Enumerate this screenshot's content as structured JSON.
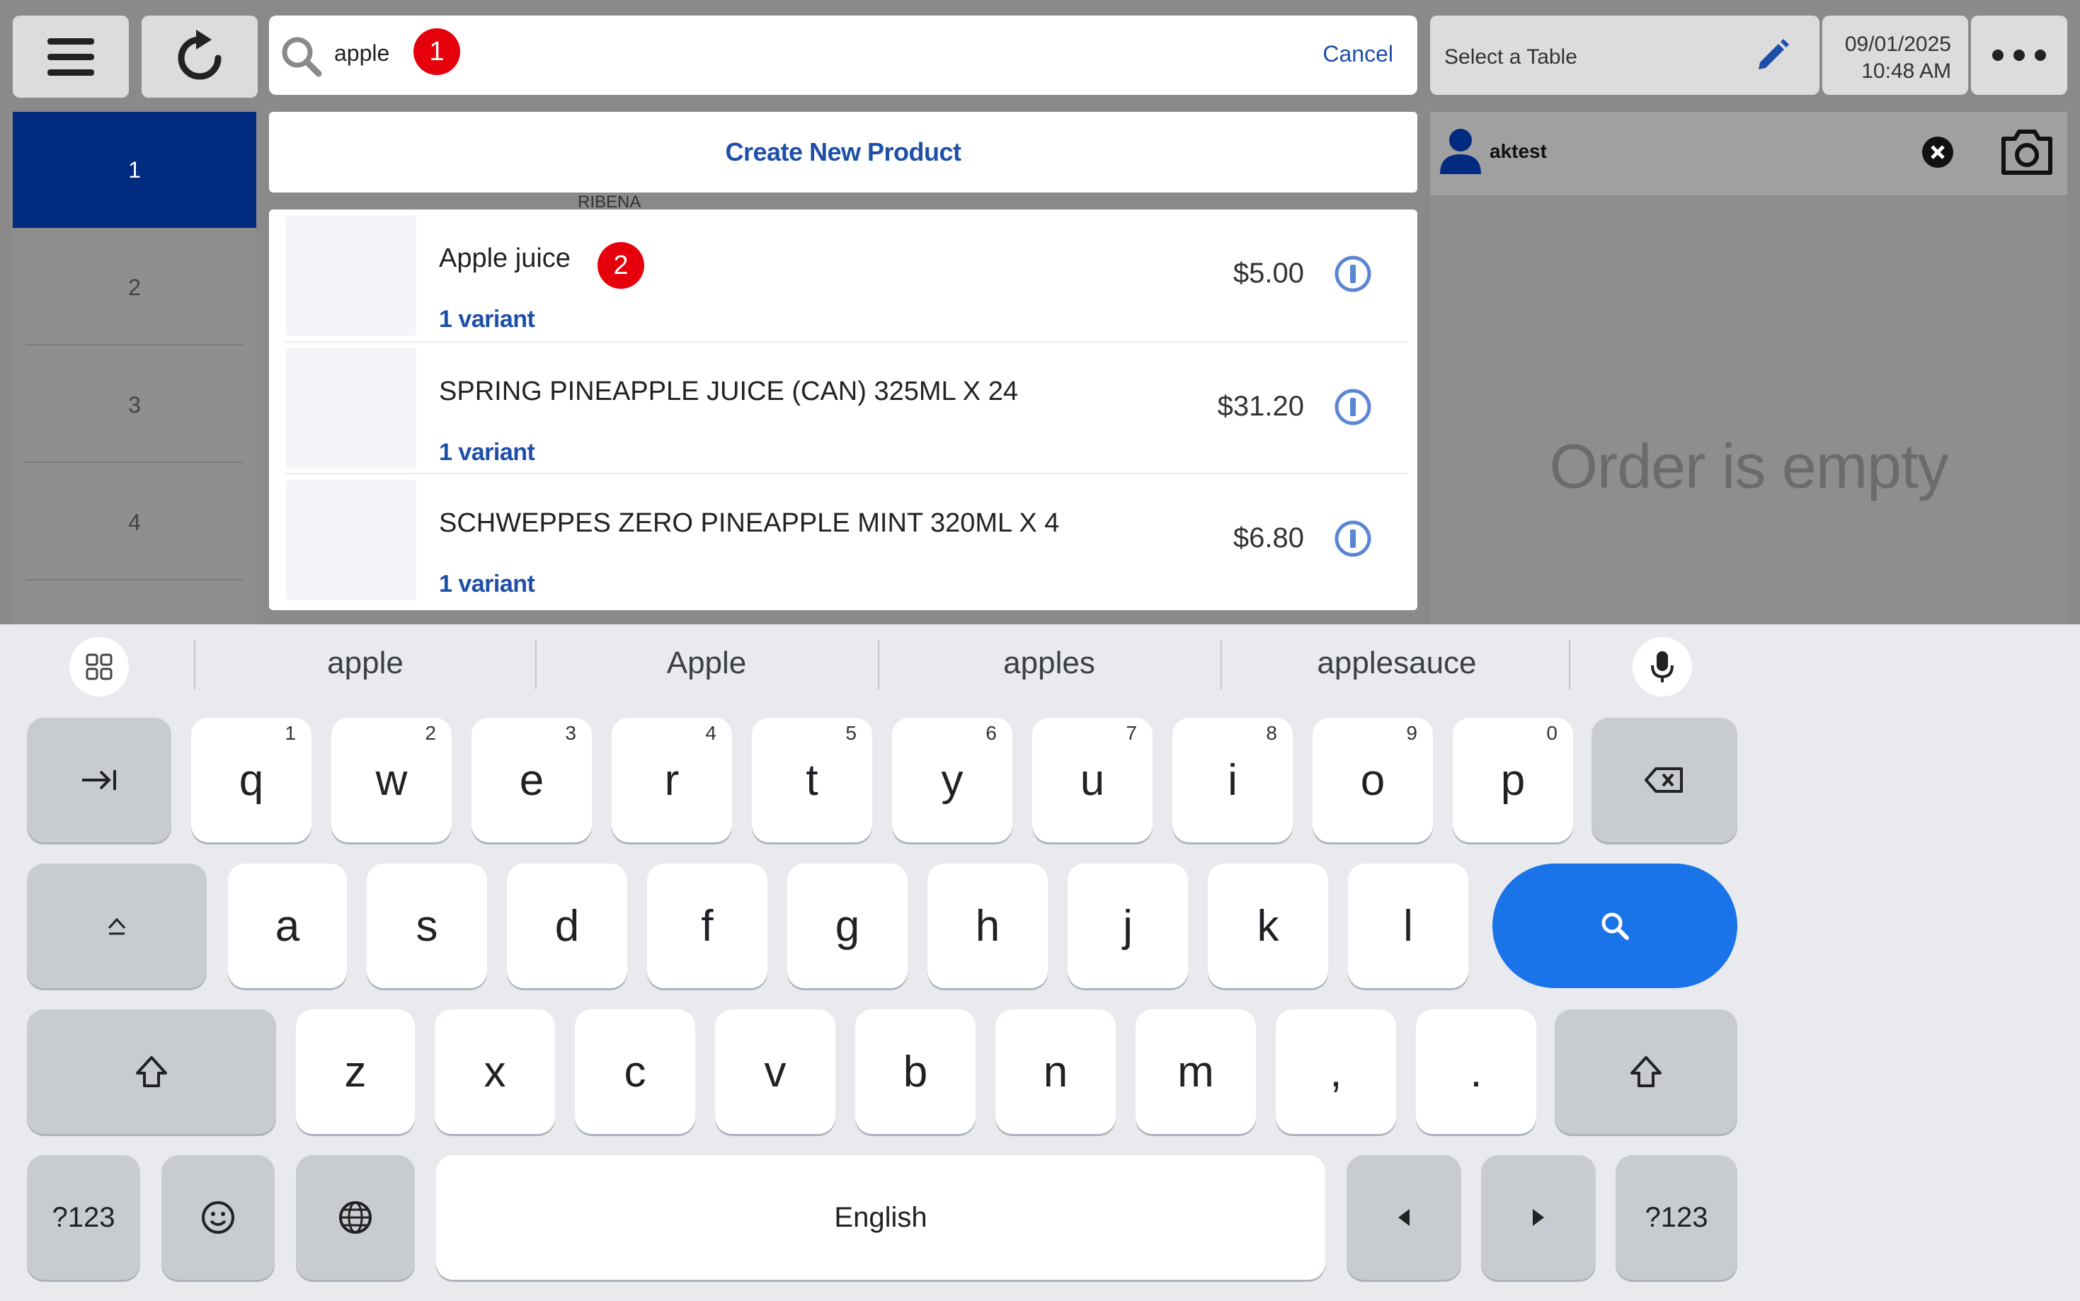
{
  "toolbar": {
    "menu_icon": "hamburger-menu-icon",
    "refresh_icon": "refresh-icon"
  },
  "search": {
    "value": "apple",
    "cancel_label": "Cancel",
    "badge_1": "1"
  },
  "tabs": [
    "1",
    "2",
    "3",
    "4"
  ],
  "create_new_label": "Create New Product",
  "background_peek": [
    "RIBENA"
  ],
  "results": [
    {
      "name": "Apple juice",
      "variant": "1 variant",
      "price": "$5.00",
      "badge": "2"
    },
    {
      "name": "SPRING PINEAPPLE JUICE (CAN) 325ML X 24",
      "variant": "1 variant",
      "price": "$31.20"
    },
    {
      "name": "SCHWEPPES ZERO PINEAPPLE MINT 320ML X 4",
      "variant": "1 variant",
      "price": "$6.80"
    }
  ],
  "right": {
    "table_label": "Select a Table",
    "date": "09/01/2025",
    "time": "10:48 AM",
    "customer": "aktest",
    "empty_text": "Order is empty"
  },
  "keyboard": {
    "suggestions": [
      "apple",
      "Apple",
      "apples",
      "applesauce"
    ],
    "row1": [
      "q",
      "w",
      "e",
      "r",
      "t",
      "y",
      "u",
      "i",
      "o",
      "p"
    ],
    "row1_nums": [
      "1",
      "2",
      "3",
      "4",
      "5",
      "6",
      "7",
      "8",
      "9",
      "0"
    ],
    "row2": [
      "a",
      "s",
      "d",
      "f",
      "g",
      "h",
      "j",
      "k",
      "l"
    ],
    "row3": [
      "z",
      "x",
      "c",
      "v",
      "b",
      "n",
      "m",
      ",",
      "."
    ],
    "symbols_label": "?123",
    "space_label": "English"
  },
  "colors": {
    "accent": "#1d4fa8",
    "active_tab": "#012b7e",
    "badge": "#e6000c",
    "keyboard_action": "#1a73e8"
  }
}
